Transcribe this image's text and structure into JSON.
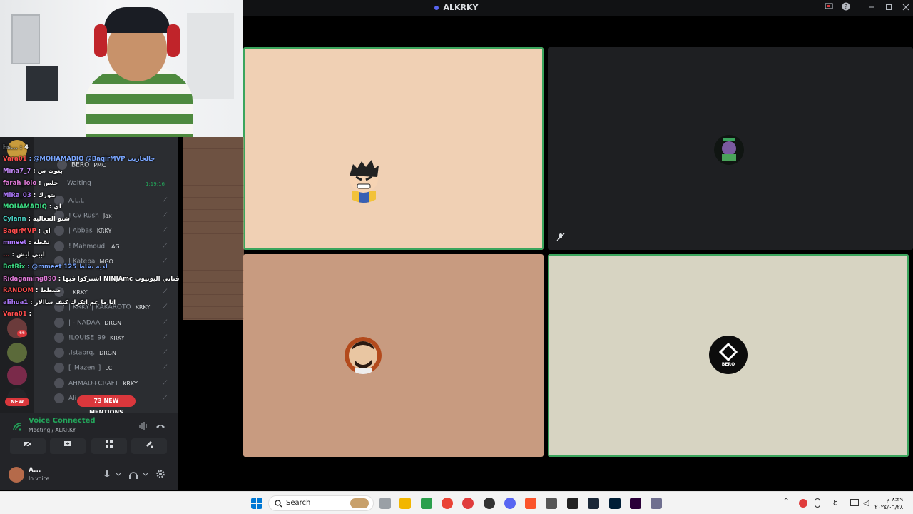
{
  "window": {
    "title": "ALKRKY"
  },
  "stage": {
    "tiles": [
      {
        "name": "tile-1",
        "bg": "#f0d0b4",
        "speaking": true
      },
      {
        "name": "tile-2",
        "bg": "#1e1f22",
        "speaking": false
      },
      {
        "name": "tile-3",
        "bg": "#c89b80",
        "speaking": false
      },
      {
        "name": "tile-4",
        "bg": "#d7d4c2",
        "speaking": true
      }
    ],
    "tile4_label": "BERO"
  },
  "members": {
    "header_name": "BERO",
    "header_tag": "PMC",
    "waiting": "Waiting",
    "waiting_time": "1:19:16",
    "rows": [
      {
        "name": "A.L.L",
        "tag": ""
      },
      {
        "name": "! Cv Rush",
        "tag": "Jax"
      },
      {
        "name": "| Abbas",
        "tag": "KRKY"
      },
      {
        "name": "! Mahmoud.",
        "tag": "AG"
      },
      {
        "name": "| Kateba",
        "tag": "MGO"
      },
      {
        "name": "",
        "tag": "KRKY"
      },
      {
        "name": "| KRKY | KAKAROTO",
        "tag": "KRKY"
      },
      {
        "name": "| - NADAA",
        "tag": "DRGN"
      },
      {
        "name": "!LOUISE_99",
        "tag": "KRKY"
      },
      {
        "name": ".Istabrq.",
        "tag": "DRGN"
      },
      {
        "name": "[_Mazen_]",
        "tag": "LC"
      },
      {
        "name": "AHMAD+CRAFT",
        "tag": "KRKY"
      },
      {
        "name": "Ali",
        "tag": ""
      }
    ]
  },
  "chat": [
    {
      "user": "hs...",
      "text": ": 4"
    },
    {
      "user": "Vara01",
      "text": ": @MOHAMADIQ @BaqirMVP جالخازبت"
    },
    {
      "user": "Mina7_7",
      "text": ": بنوت س"
    },
    {
      "user": "farah_lolo",
      "text": ": خلص"
    },
    {
      "user": "MiRa_03",
      "text": ": بتورك"
    },
    {
      "user": "MOHAMADIQ",
      "text": ": اي"
    },
    {
      "user": "Cylann",
      "text": ": شنو الفعاليه"
    },
    {
      "user": "BaqirMVP",
      "text": ": اي"
    },
    {
      "user": "mmeet",
      "text": ": نقطة"
    },
    {
      "user": "...",
      "text": ": ابيي ليش"
    },
    {
      "user": "BotRix",
      "text": ": @mmeet لديه نقاط 125"
    },
    {
      "user": "Ridagaming890",
      "text": ": اشتركوا فيها NINJAmc قناتي اليوتيوب"
    },
    {
      "user": "RANDOM",
      "text": ": ضبطط"
    },
    {
      "user": "alihua1",
      "text": ": انا ما عم اتكرك كيف ساالار"
    },
    {
      "user": "Vara01",
      "text": ":"
    }
  ],
  "badges": {
    "server_count": "66",
    "new_label": "NEW",
    "mentions_label": "73 NEW MENTIONS"
  },
  "voice": {
    "status": "Voice Connected",
    "channel": "Meeting / ALKRKY",
    "user_name": "A...",
    "user_status": "In voice"
  },
  "taskbar": {
    "search_label": "Search",
    "time": "٨:٣٩ م",
    "date": "٢٠٢٤/٠٦/٢٨",
    "lang": "ع"
  },
  "colors": {
    "accent": "#5865f2",
    "speaking": "#3ba55d",
    "danger": "#da373c",
    "voice_green": "#23a55a"
  }
}
